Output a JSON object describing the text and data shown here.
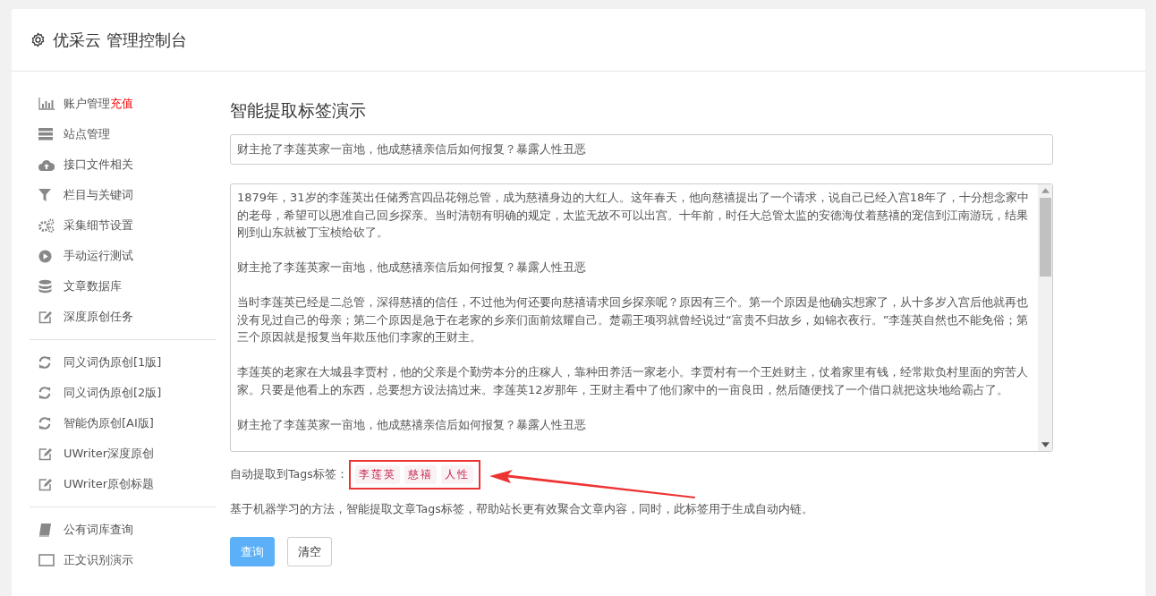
{
  "header": {
    "title": "优采云 管理控制台"
  },
  "sidebar": {
    "groups": [
      {
        "items": [
          {
            "label": "账户管理",
            "badge": "充值"
          },
          {
            "label": "站点管理"
          },
          {
            "label": "接口文件相关"
          },
          {
            "label": "栏目与关键词"
          },
          {
            "label": "采集细节设置"
          },
          {
            "label": "手动运行测试"
          },
          {
            "label": "文章数据库"
          },
          {
            "label": "深度原创任务"
          }
        ]
      },
      {
        "items": [
          {
            "label": "同义词伪原创[1版]"
          },
          {
            "label": "同义词伪原创[2版]"
          },
          {
            "label": "智能伪原创[AI版]"
          },
          {
            "label": "UWriter深度原创"
          },
          {
            "label": "UWriter原创标题"
          }
        ]
      },
      {
        "items": [
          {
            "label": "公有词库查询"
          },
          {
            "label": "正文识别演示"
          }
        ]
      }
    ]
  },
  "main": {
    "heading": "智能提取标签演示",
    "title_field": {
      "value": "财主抢了李莲英家一亩地，他成慈禧亲信后如何报复？暴露人性丑恶"
    },
    "content_field": {
      "paragraphs": [
        "1879年，31岁的李莲英出任储秀宫四品花翎总管，成为慈禧身边的大红人。这年春天，他向慈禧提出了一个请求，说自己已经入宫18年了，十分想念家中的老母，希望可以恩准自己回乡探亲。当时清朝有明确的规定，太监无故不可以出宫。十年前，时任大总管太监的安德海仗着慈禧的宠信到江南游玩，结果刚到山东就被丁宝桢给砍了。",
        "财主抢了李莲英家一亩地，他成慈禧亲信后如何报复？暴露人性丑恶",
        "当时李莲英已经是二总管，深得慈禧的信任，不过他为何还要向慈禧请求回乡探亲呢？原因有三个。第一个原因是他确实想家了，从十多岁入宫后他就再也没有见过自己的母亲；第二个原因是急于在老家的乡亲们面前炫耀自己。楚霸王项羽就曾经说过“富贵不归故乡，如锦衣夜行。”李莲英自然也不能免俗；第三个原因就是报复当年欺压他们李家的王财主。",
        "李莲英的老家在大城县李贾村，他的父亲是个勤劳本分的庄稼人，靠种田养活一家老小。李贾村有一个王姓财主，仗着家里有钱，经常欺负村里面的穷苦人家。只要是他看上的东西，总要想方设法搞过来。李莲英12岁那年，王财主看中了他们家中的一亩良田，然后随便找了一个借口就把这块地给霸占了。",
        "财主抢了李莲英家一亩地，他成慈禧亲信后如何报复？暴露人性丑恶"
      ]
    },
    "tags_label": "自动提取到Tags标签：",
    "tags": [
      "李莲英",
      "慈禧",
      "人性"
    ],
    "description": "基于机器学习的方法，智能提取文章Tags标签，帮助站长更有效聚合文章内容，同时，此标签用于生成自动内链。",
    "buttons": [
      {
        "label": "查询",
        "kind": "primary"
      },
      {
        "label": "清空",
        "kind": "default"
      }
    ]
  }
}
